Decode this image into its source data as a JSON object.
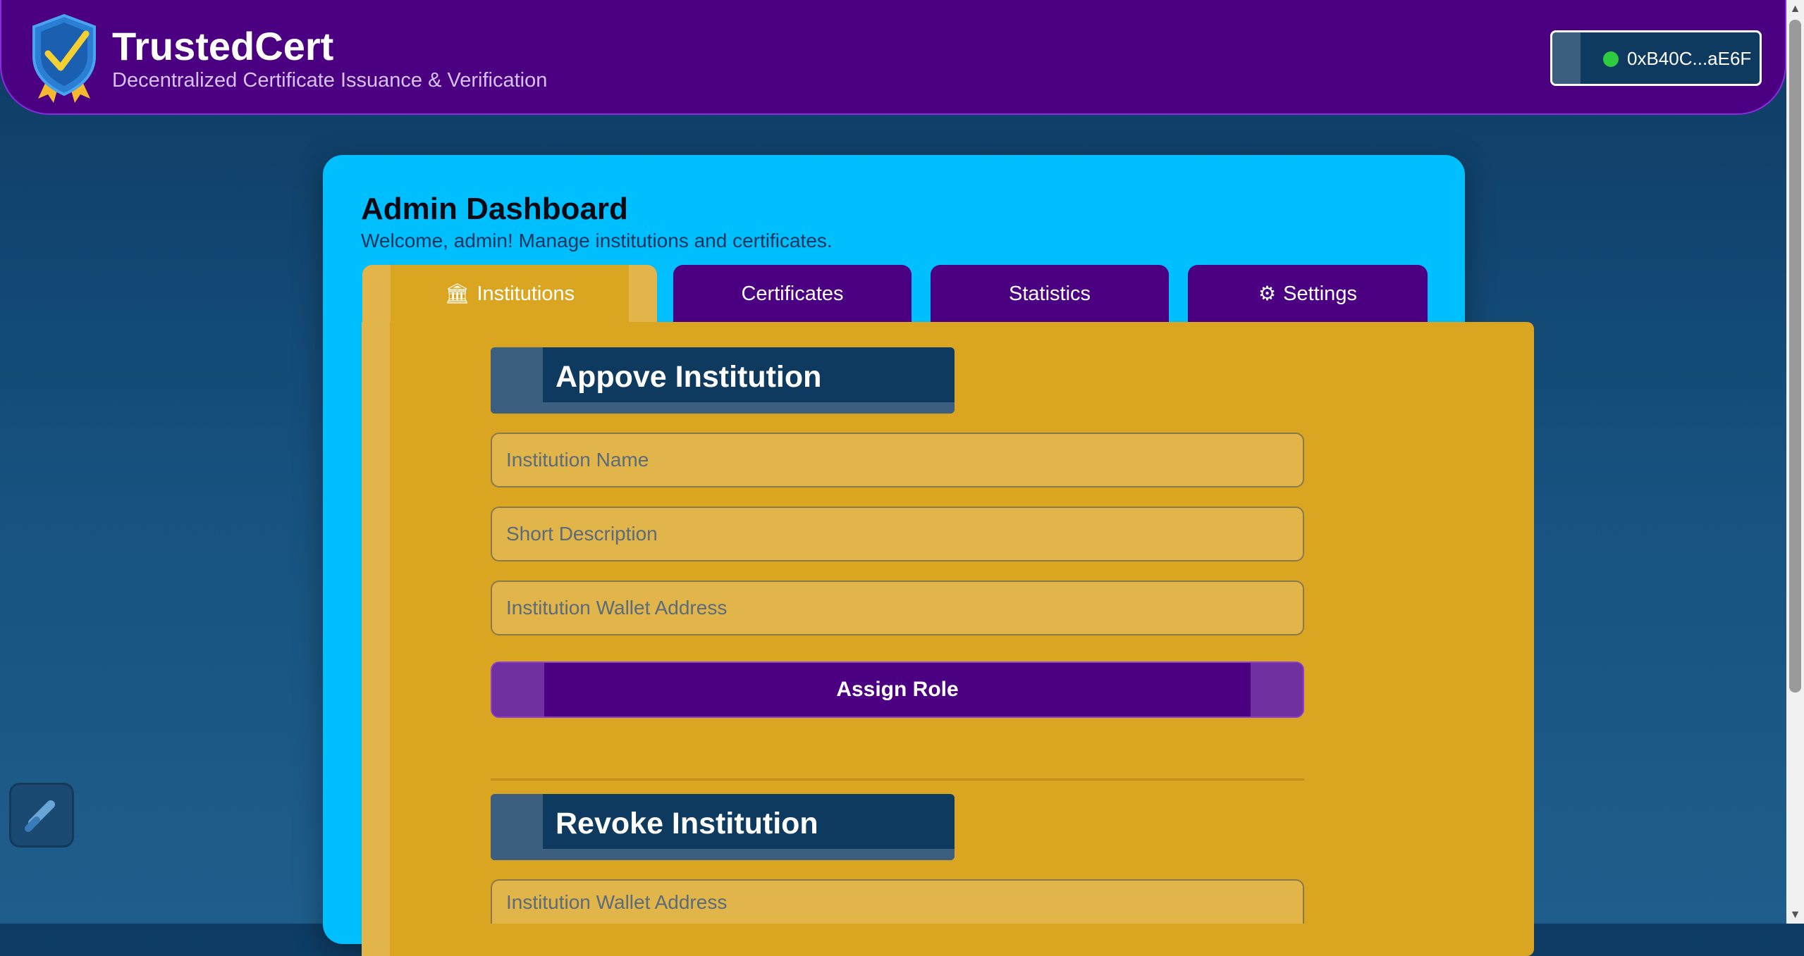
{
  "header": {
    "brand_name": "TrustedCert",
    "tagline": "Decentralized Certificate Issuance & Verification",
    "wallet_address": "0xB40C...aE6F",
    "wallet_status_color": "#2ecc40"
  },
  "dashboard": {
    "title": "Admin Dashboard",
    "subtitle": "Welcome, admin! Manage institutions and certificates."
  },
  "tabs": [
    {
      "label": "Institutions",
      "icon": "bank-icon",
      "active": true
    },
    {
      "label": "Certificates",
      "active": false
    },
    {
      "label": "Statistics",
      "active": false
    },
    {
      "label": "Settings",
      "icon": "gear-icon",
      "active": false
    }
  ],
  "approve_section": {
    "title": "Appove Institution",
    "name_placeholder": "Institution Name",
    "description_placeholder": "Short Description",
    "wallet_placeholder": "Institution Wallet Address",
    "submit_label": "Assign Role"
  },
  "revoke_section": {
    "title": "Revoke Institution",
    "wallet_placeholder": "Institution Wallet Address"
  },
  "colors": {
    "header_bg": "#4b0082",
    "card_bg": "#00bfff",
    "panel_bg": "#daa520",
    "accent": "#8a2be2"
  }
}
